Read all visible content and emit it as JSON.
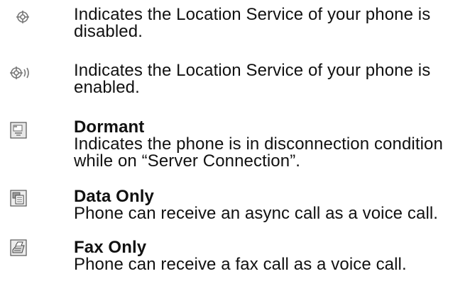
{
  "entries": [
    {
      "icon": "location-disabled-icon",
      "title": "",
      "description": "Indicates the Location Service of your phone is disabled."
    },
    {
      "icon": "location-enabled-icon",
      "title": "",
      "description": "Indicates the Location Service of your phone is enabled."
    },
    {
      "icon": "dormant-icon",
      "title": "Dormant",
      "description": "Indicates the phone is in disconnection condition while on “Server Connection”."
    },
    {
      "icon": "data-only-icon",
      "title": "Data Only",
      "description": "Phone can receive an async call as a voice call."
    },
    {
      "icon": "fax-only-icon",
      "title": "Fax Only",
      "description": "Phone can receive a fax call as a voice call."
    }
  ]
}
